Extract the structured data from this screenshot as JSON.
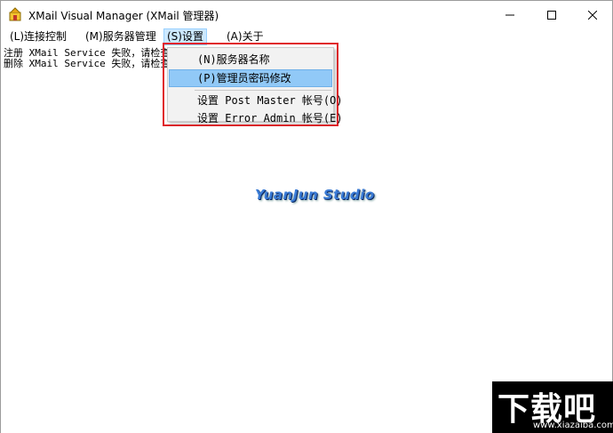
{
  "window": {
    "title": "XMail Visual Manager (XMail 管理器)"
  },
  "menubar": {
    "items": [
      {
        "label": "(L)连接控制"
      },
      {
        "label": "(M)服务器管理"
      },
      {
        "label": "(S)设置"
      },
      {
        "label": "(A)关于"
      }
    ]
  },
  "log": {
    "lines": [
      "注册 XMail Service 失败，请检查",
      "删除 XMail Service 失败，请检查"
    ]
  },
  "dropdown": {
    "items": [
      {
        "label": "(N)服务器名称"
      },
      {
        "label": "(P)管理员密码修改"
      },
      {
        "label": "设置 Post Master 帐号(O)"
      },
      {
        "label": "设置 Error Admin 帐号(E)"
      }
    ]
  },
  "watermark": {
    "logo": "YuanJun Studio"
  },
  "site_watermark": {
    "big": "下载吧",
    "small": "www.xiazaiba.com"
  },
  "colors": {
    "highlight_box": "#e0232b",
    "menu_active_bg": "#cce8ff",
    "dropdown_hover_bg": "#91c9f7",
    "logo_blue": "#3a7bd5"
  }
}
